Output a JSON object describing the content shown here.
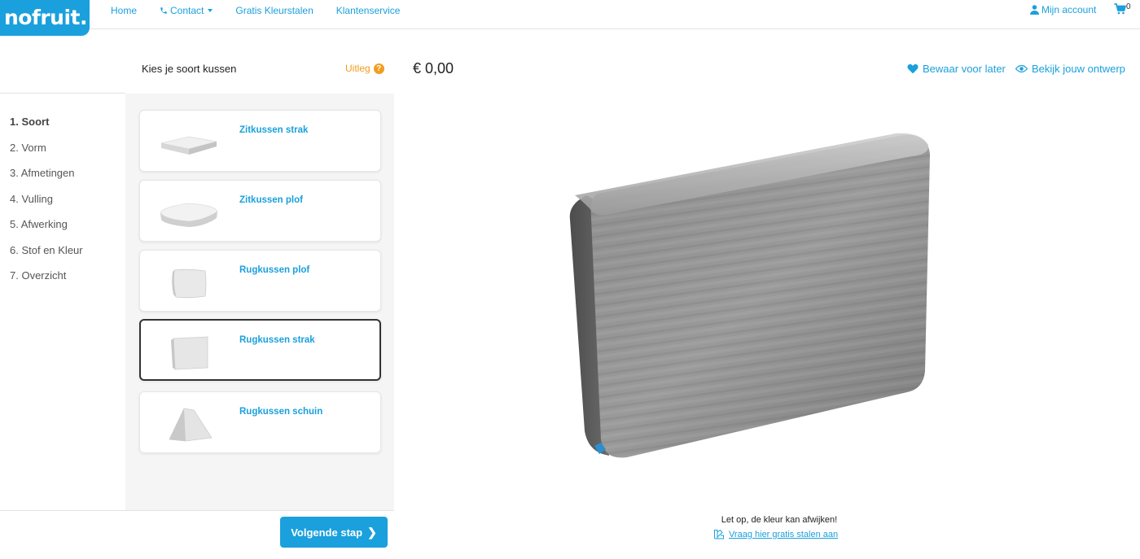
{
  "brand": {
    "logo": "nofruit.",
    "accent": "#1aa0dc",
    "orange": "#f39c1e"
  },
  "nav": {
    "home": "Home",
    "contact": "Contact",
    "swatches": "Gratis Kleurstalen",
    "service": "Klantenservice",
    "account": "Mijn account",
    "cart_count": "0"
  },
  "steps": [
    "1. Soort",
    "2. Vorm",
    "3. Afmetingen",
    "4. Vulling",
    "5. Afwerking",
    "6. Stof en Kleur",
    "7. Overzicht"
  ],
  "panel": {
    "title": "Kies je soort kussen",
    "help": "Uitleg",
    "help_icon": "?",
    "options": [
      {
        "label": "Zitkussen strak",
        "icon": "flat-seat-cushion-icon"
      },
      {
        "label": "Zitkussen plof",
        "icon": "puffy-seat-cushion-icon"
      },
      {
        "label": "Rugkussen plof",
        "icon": "puffy-back-cushion-icon"
      },
      {
        "label": "Rugkussen strak",
        "icon": "flat-back-cushion-icon",
        "selected": true
      },
      {
        "label": "Rugkussen schuin",
        "icon": "wedge-back-cushion-icon"
      }
    ],
    "next_button": "Volgende stap",
    "next_icon": "❯"
  },
  "preview": {
    "price": "€ 0,00",
    "save_later": "Bewaar voor later",
    "view_design": "Bekijk jouw ontwerp",
    "note": "Let op, de kleur kan afwijken!",
    "samples_link": "Vraag hier gratis stalen aan"
  }
}
